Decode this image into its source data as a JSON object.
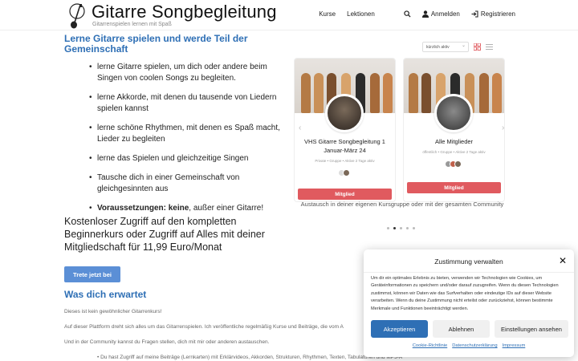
{
  "header": {
    "site_title": "Gitarre Songbegleitung",
    "tagline": "Gitarrenspielen lernen mit Spaß",
    "nav": {
      "kurse": "Kurse",
      "lektionen": "Lektionen",
      "anmelden": "Anmelden",
      "registrieren": "Registrieren"
    },
    "icons": [
      "guitar-logo-icon",
      "search-icon",
      "user-icon",
      "login-icon"
    ]
  },
  "hero": {
    "title": "Lerne Gitarre spielen und werde Teil der Gemeinschaft",
    "bullets": [
      "lerne Gitarre spielen, um dich oder andere beim Singen von coolen Songs zu begleiten.",
      "lerne Akkorde, mit denen du tausende von Liedern spielen kannst",
      "lerne schöne Rhythmen, mit denen es Spaß macht, Lieder zu begleiten",
      "lerne das Spielen und gleichzeitige Singen",
      "Tausche dich in einer Gemeinschaft von gleichgesinnten aus"
    ],
    "requirement_bold": "Voraussetzungen: keine",
    "requirement_rest": ", außer einer Gitarre!"
  },
  "offer": {
    "text": "Kostenloser Zugriff auf den kompletten Beginnerkurs oder Zugriff auf Alles mit deiner Mitgliedschaft für 11,99 Euro/Monat",
    "cta_label": "Trete jetzt bei"
  },
  "expect": {
    "title": "Was dich erwartet",
    "paragraphs": [
      "Dieses ist kein gewöhnlicher Gitarrenkurs!",
      "Auf dieser Plattform dreht sich alles um das Gitarrenspielen. Ich veröffentliche regelmäßig Kurse und Beiträge, die vom A",
      "Und in der Community kannst du Fragen stellen, dich mit mir oder anderen austauschen.",
      "• Du hast Zugriff auf meine Beiträge (Lernkarten) mit Erklärvideos, Akkorden, Strukturen, Rhythmen, Texten, Tabulaturen und MP3-Audios"
    ]
  },
  "groups_panel": {
    "sort_select": "kürzlich aktiv",
    "cards": [
      {
        "title": "VHS Gitarre Songbegleitung 1 Januar-März 24",
        "meta": "Private  •  Gruppe  •  Aktive 2 Tage aktiv",
        "button": "Mitglied"
      },
      {
        "title": "Alle Mitglieder",
        "meta": "öffentlich  •  Gruppe  •  Aktive 2 Tage aktiv",
        "button": "Mitglied"
      }
    ],
    "caption": "Austausch in deiner eigenen Kursgruppe oder mit der gesamten Community",
    "slider_dots": 5,
    "active_dot": 2
  },
  "cookie_modal": {
    "title": "Zustimmung verwalten",
    "text": "Um dir ein optimales Erlebnis zu bieten, verwenden wir Technologien wie Cookies, um Geräteinformationen zu speichern und/oder darauf zuzugreifen. Wenn du diesen Technologien zustimmst, können wir Daten wie das Surfverhalten oder eindeutige IDs auf dieser Website verarbeiten. Wenn du deine Zustimmung nicht erteilst oder zurückziehst, können bestimmte Merkmale und Funktionen beeinträchtigt werden.",
    "accept": "Akzeptieren",
    "deny": "Ablehnen",
    "settings": "Einstellungen ansehen",
    "links": [
      "Cookie-Richtlinie",
      "Datenschutzerklärung",
      "Impressum"
    ]
  },
  "colors": {
    "accent_blue": "#2e6fb5",
    "cta_blue": "#5b8fd6",
    "member_red": "#e05a5f"
  }
}
